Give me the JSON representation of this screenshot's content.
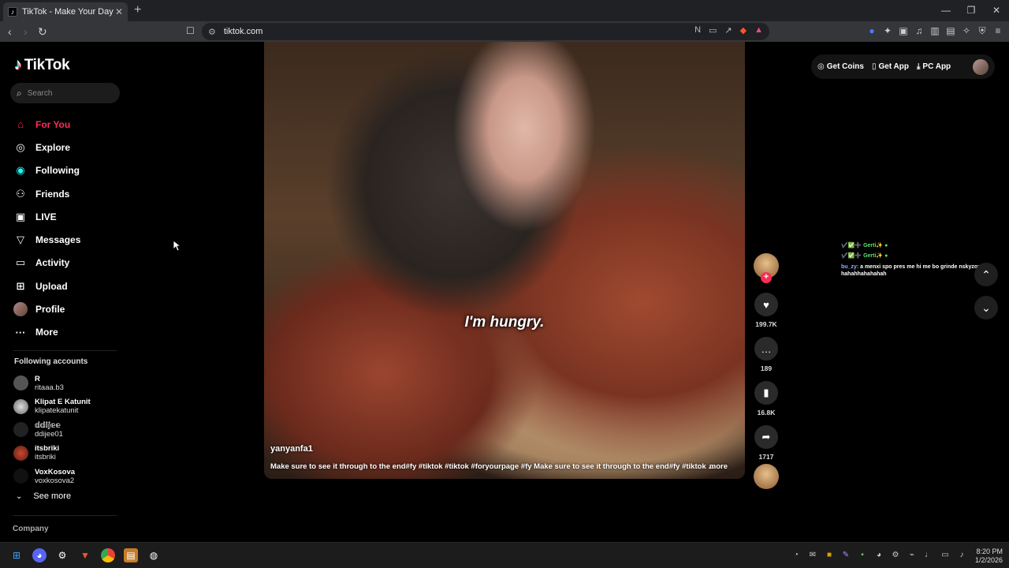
{
  "browser": {
    "tab_title": "TikTok - Make Your Day",
    "tab_close": "✕",
    "new_tab": "+",
    "url": "tikto‌k.com",
    "window_controls": [
      "—",
      "❐",
      "✕"
    ]
  },
  "sidebar": {
    "logo": "TikTok",
    "search_placeholder": "Search",
    "nav": [
      {
        "label": "For You",
        "icon": "home-icon",
        "glyph": "⌂"
      },
      {
        "label": "Explore",
        "icon": "compass-icon",
        "glyph": "◎"
      },
      {
        "label": "Following",
        "icon": "following-icon",
        "glyph": "◉"
      },
      {
        "label": "Friends",
        "icon": "friends-icon",
        "glyph": "⚇"
      },
      {
        "label": "LIVE",
        "icon": "live-icon",
        "glyph": "▣"
      },
      {
        "label": "Messages",
        "icon": "messages-icon",
        "glyph": "▽"
      },
      {
        "label": "Activity",
        "icon": "activity-icon",
        "glyph": "▭"
      },
      {
        "label": "Upload",
        "icon": "upload-icon",
        "glyph": "⊞"
      },
      {
        "label": "Profile",
        "icon": "profile-avatar-icon",
        "glyph": ""
      },
      {
        "label": "More",
        "icon": "more-icon",
        "glyph": "···"
      }
    ],
    "following_title": "Following accounts",
    "accounts": [
      {
        "name": "R",
        "handle": "ritaaa.b3"
      },
      {
        "name": "Klipat E Katunit",
        "handle": "klipatekatunit"
      },
      {
        "name": "𝕕𝕕𝕚𝕛𝕖𝕖",
        "handle": "ddijee01"
      },
      {
        "name": "itsbriki",
        "handle": "itsbriki"
      },
      {
        "name": "VoxKosova",
        "handle": "voxkosova2"
      }
    ],
    "see_more": "See more",
    "company": "Company"
  },
  "video": {
    "subtitle": "I'm hungry.",
    "author": "yanyanfa1",
    "caption": "Make sure to see it through to the end#fy #tiktok #tiktok #foryourpage #fy Make sure to see it through to the end#fy #tiktok ...",
    "more": "more"
  },
  "actions": {
    "likes": "199.7K",
    "comments": "189",
    "saves": "16.8K",
    "shares": "1717"
  },
  "topright": {
    "coins": "Get Coins",
    "app": "Get App",
    "pc_app": "PC App"
  },
  "chat": {
    "line1_user": "✔️✅➕ Gerti✨",
    "line2_user": "✔️✅➕ Gerti✨",
    "line3_user": "bu_zy:",
    "line3_text": "a menxi spo pres me hi me bo grinde nskyzone hahahhahahahah"
  },
  "clock": {
    "time": "8:20 PM",
    "date": "1/2/2026"
  },
  "colors": {
    "accent": "#fe2c55",
    "background": "#000000"
  }
}
